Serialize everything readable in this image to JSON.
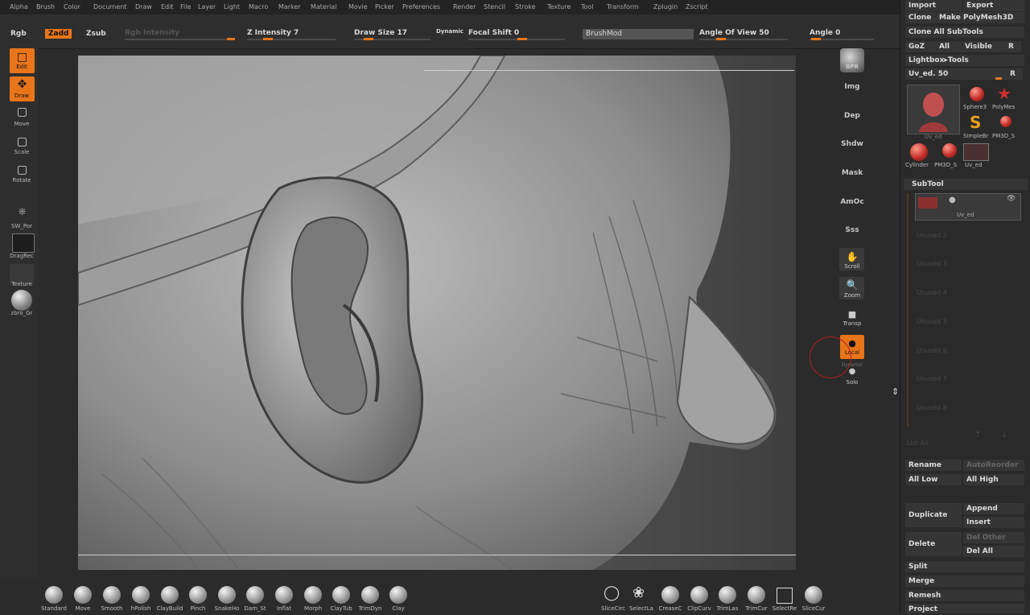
{
  "menu": [
    "Alpha",
    "Brush",
    "Color",
    "Document",
    "Draw",
    "Edit",
    "File",
    "Layer",
    "Light",
    "Macro",
    "Marker",
    "Material",
    "Movie",
    "Picker",
    "Preferences",
    "Render",
    "Stencil",
    "Stroke",
    "Texture",
    "Tool",
    "Transform",
    "Zplugin",
    "Zscript"
  ],
  "toolbar": {
    "rgb": "Rgb",
    "zadd": "Zadd",
    "zsub": "Zsub",
    "rgb_intensity": "Rgb Intensity",
    "z_intensity": "Z Intensity 7",
    "draw_size": "Draw Size 17",
    "dynamic": "Dynamic",
    "focal_shift": "Focal Shift 0",
    "brushmod": "BrushMod",
    "angle_of_view": "Angle Of View 50",
    "angle": "Angle 0",
    "z_intensity_value": 7,
    "draw_size_value": 17
  },
  "left_shelf": {
    "edit": "Edit",
    "draw": "Draw",
    "move": "Move",
    "scale": "Scale",
    "rotate": "Rotate",
    "sw_por": "SW_Por",
    "dragrect": "DragRec",
    "texture": "Texture",
    "material": "zbro_Gr"
  },
  "right_shelf": {
    "bpr": "BPR",
    "img": "Img",
    "dep": "Dep",
    "shdw": "Shdw",
    "mask": "Mask",
    "amoc": "AmOc",
    "sss": "Sss",
    "scroll": "Scroll",
    "zoom": "Zoom",
    "transp": "Transp",
    "local": "Local",
    "dynamic": "Dynamic",
    "solo": "Solo"
  },
  "bottom_brushes": [
    "Standard",
    "Move",
    "Smooth",
    "hPolish",
    "ClayBuild",
    "Pinch",
    "SnakeHo",
    "Dam_St",
    "Inflat",
    "Morph",
    "ClayTub",
    "TrimDyn",
    "Clay"
  ],
  "bottom_tools": [
    "SliceCirc",
    "SelectLa",
    "CreaseC",
    "ClipCurv",
    "TrimLas",
    "TrimCur",
    "SelectRe",
    "SliceCur"
  ],
  "panel": {
    "import": "Import",
    "export": "Export",
    "clone": "Clone",
    "make_polymesh": "Make PolyMesh3D",
    "clone_all": "Clone All SubTools",
    "goz": "GoZ",
    "all": "All",
    "visible": "Visible",
    "r": "R",
    "lightbox_tools": "Lightbox▸Tools",
    "uv_ed": "Uv_ed. 50",
    "uv_ed_value": 50,
    "r2": "R",
    "tools": [
      {
        "label": "Uv_ed"
      },
      {
        "label": "Sphere3"
      },
      {
        "label": "PolyMes"
      },
      {
        "label": "SimpleBr"
      },
      {
        "label": "PM3D_S"
      },
      {
        "label": "Cylinder"
      },
      {
        "label": "PM3D_S"
      },
      {
        "label": "Uv_ed"
      }
    ],
    "subtool": "SubTool",
    "subtool_item": "Uv_ed",
    "subtool_empty": [
      "Unused 2",
      "Unused 3",
      "Unused 4",
      "Unused 5",
      "Unused 6",
      "Unused 7",
      "Unused 8"
    ],
    "list_all": "List All",
    "rename": "Rename",
    "autoreorder": "AutoReorder",
    "all_low": "All Low",
    "all_high": "All High",
    "duplicate": "Duplicate",
    "append": "Append",
    "insert": "Insert",
    "delete": "Delete",
    "del_other": "Del Other",
    "del_all": "Del All",
    "split": "Split",
    "merge": "Merge",
    "remesh": "Remesh",
    "project": "Project"
  }
}
